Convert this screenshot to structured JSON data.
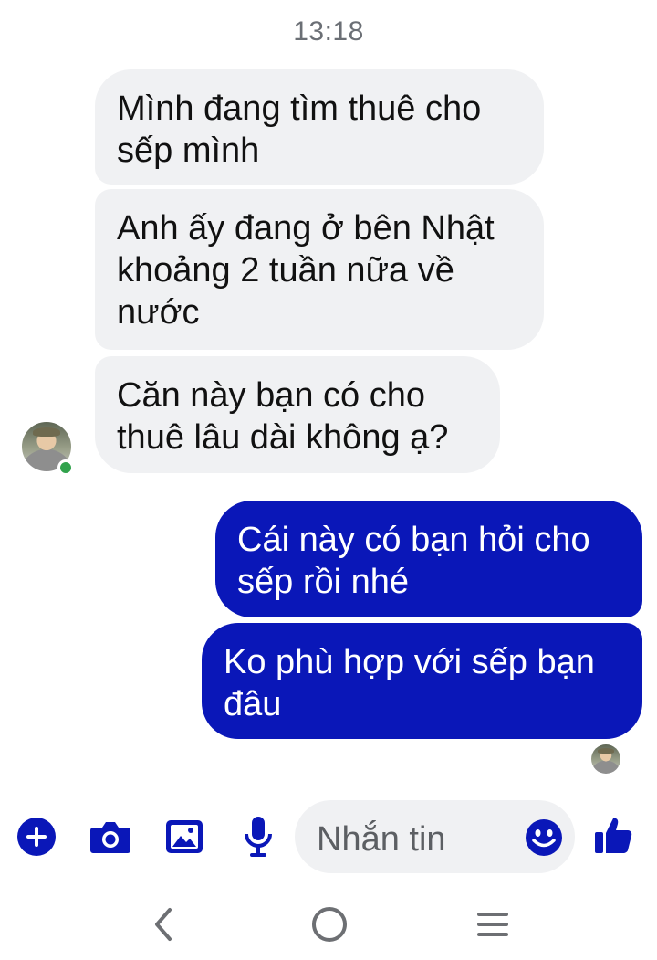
{
  "timestamp": "13:18",
  "messages": [
    {
      "direction": "incoming",
      "text": "Mình đang tìm thuê cho sếp mình"
    },
    {
      "direction": "incoming",
      "text": "Anh ấy đang ở bên Nhật khoảng 2 tuần nữa về nước"
    },
    {
      "direction": "incoming",
      "text": "Căn này bạn có cho thuê lâu dài không ạ?"
    },
    {
      "direction": "outgoing",
      "text": "Cái này có bạn hỏi cho sếp rồi nhé"
    },
    {
      "direction": "outgoing",
      "text": "Ko phù hợp với sếp bạn đâu"
    }
  ],
  "composer": {
    "placeholder": "Nhắn tin",
    "icons": [
      "plus-icon",
      "camera-icon",
      "image-icon",
      "microphone-icon",
      "emoji-icon",
      "thumbs-up-icon"
    ]
  },
  "navbar": {
    "icons": [
      "back-icon",
      "home-icon",
      "recents-icon"
    ]
  },
  "colors": {
    "accent": "#0a17b8",
    "incoming_bubble": "#f0f1f3",
    "online": "#31a24c"
  }
}
